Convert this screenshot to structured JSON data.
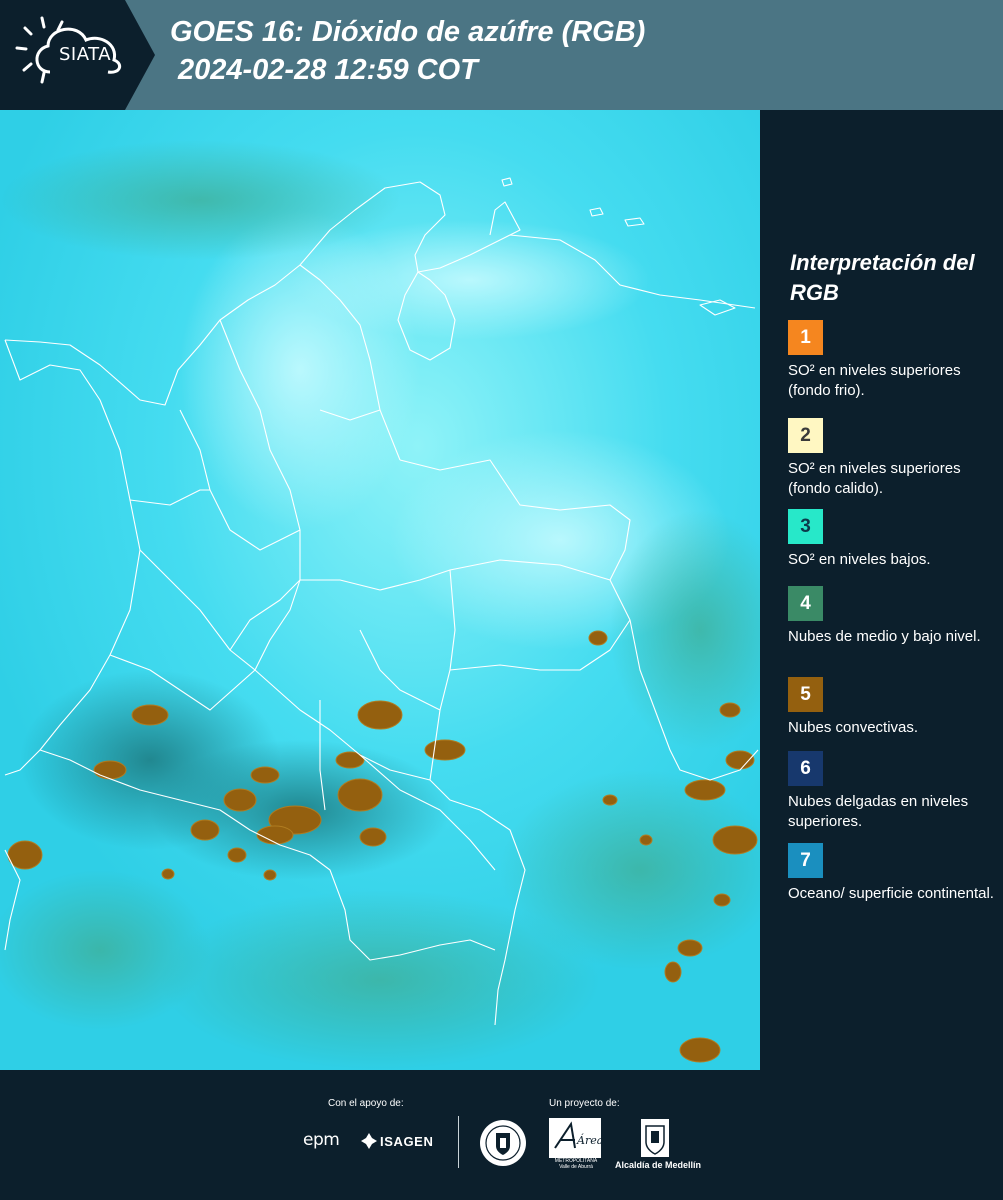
{
  "header": {
    "logo_text": "SIATA",
    "title": "GOES 16: Dióxido de azúfre (RGB)",
    "timestamp": "2024-02-28 12:59 COT",
    "background_color": "#4b7584"
  },
  "legend": {
    "title": "Interpretación del RGB",
    "items": [
      {
        "number": "1",
        "color": "#f5861f",
        "text_color": "#ffffff",
        "label": "SO² en niveles superiores (fondo frio)."
      },
      {
        "number": "2",
        "color": "#fff7c2",
        "text_color": "#3a3a3a",
        "label": "SO² en niveles superiores (fondo calido)."
      },
      {
        "number": "3",
        "color": "#27e8c9",
        "text_color": "#0c3a4a",
        "label": "SO² en niveles bajos."
      },
      {
        "number": "4",
        "color": "#3a8a66",
        "text_color": "#ffffff",
        "label": "Nubes de medio y bajo nivel."
      },
      {
        "number": "5",
        "color": "#94600f",
        "text_color": "#ffffff",
        "label": "Nubes convectivas."
      },
      {
        "number": "6",
        "color": "#17386d",
        "text_color": "#ffffff",
        "label": "Nubes delgadas en niveles superiores."
      },
      {
        "number": "7",
        "color": "#1a8fbf",
        "text_color": "#ffffff",
        "label": "Oceano/ superficie continental."
      }
    ]
  },
  "map": {
    "background_color": "#33d3ec",
    "border_color": "#ffffff",
    "convective_color": "#94600f"
  },
  "footer": {
    "support_label": "Con el apoyo de:",
    "project_label": "Un proyecto de:",
    "sponsors": [
      "epm",
      "ISAGEN"
    ],
    "partners": [
      "Medellín",
      "Área Metropolitana",
      "Alcaldía de Medellín"
    ],
    "area_logo_text": "Área",
    "area_caption": "METROPOLITANA Valle de Aburrá",
    "alcaldia_text": "Alcaldía de Medellín"
  }
}
